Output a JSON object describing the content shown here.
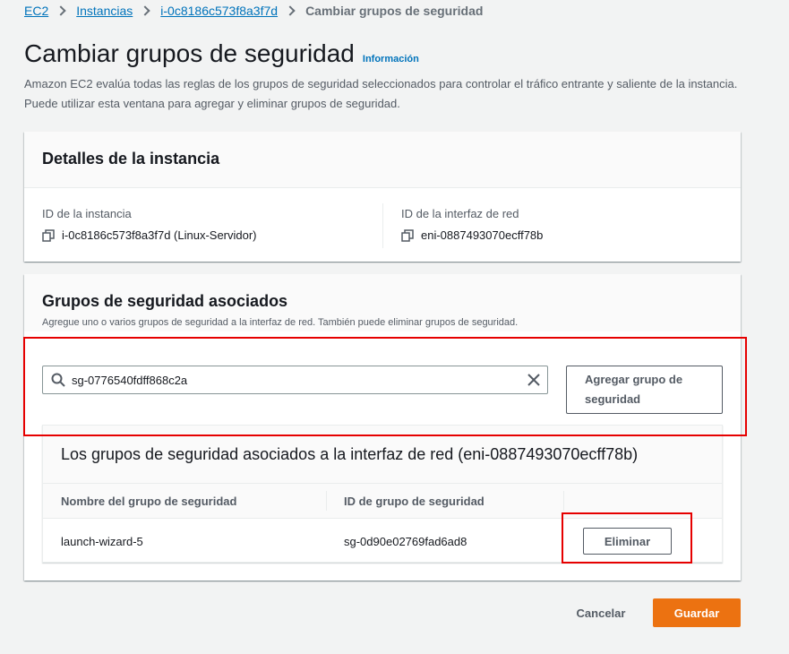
{
  "breadcrumb": {
    "items": [
      "EC2",
      "Instancias",
      "i-0c8186c573f8a3f7d"
    ],
    "current": "Cambiar grupos de seguridad"
  },
  "header": {
    "title": "Cambiar grupos de seguridad",
    "info_link": "Información",
    "description": "Amazon EC2 evalúa todas las reglas de los grupos de seguridad seleccionados para controlar el tráfico entrante y saliente de la instancia. Puede utilizar esta ventana para agregar y eliminar grupos de seguridad."
  },
  "instance_details": {
    "title": "Detalles de la instancia",
    "instance_id_label": "ID de la instancia",
    "instance_id_value": "i-0c8186c573f8a3f7d (Linux-Servidor)",
    "eni_label": "ID de la interfaz de red",
    "eni_value": "eni-0887493070ecff78b"
  },
  "security_groups": {
    "title": "Grupos de seguridad asociados",
    "subtitle": "Agregue uno o varios grupos de seguridad a la interfaz de red. También puede eliminar grupos de seguridad.",
    "search_value": "sg-0776540fdff868c2a",
    "add_button": "Agregar grupo de seguridad",
    "table": {
      "title": "Los grupos de seguridad asociados a la interfaz de red (eni-0887493070ecff78b)",
      "columns": [
        "Nombre del grupo de seguridad",
        "ID de grupo de seguridad"
      ],
      "rows": [
        {
          "name": "launch-wizard-5",
          "id": "sg-0d90e02769fad6ad8",
          "action": "Eliminar"
        }
      ]
    }
  },
  "footer": {
    "cancel_label": "Cancelar",
    "save_label": "Guardar"
  },
  "colors": {
    "link": "#0073bb",
    "primary": "#ec7211",
    "highlight": "#e60000"
  }
}
